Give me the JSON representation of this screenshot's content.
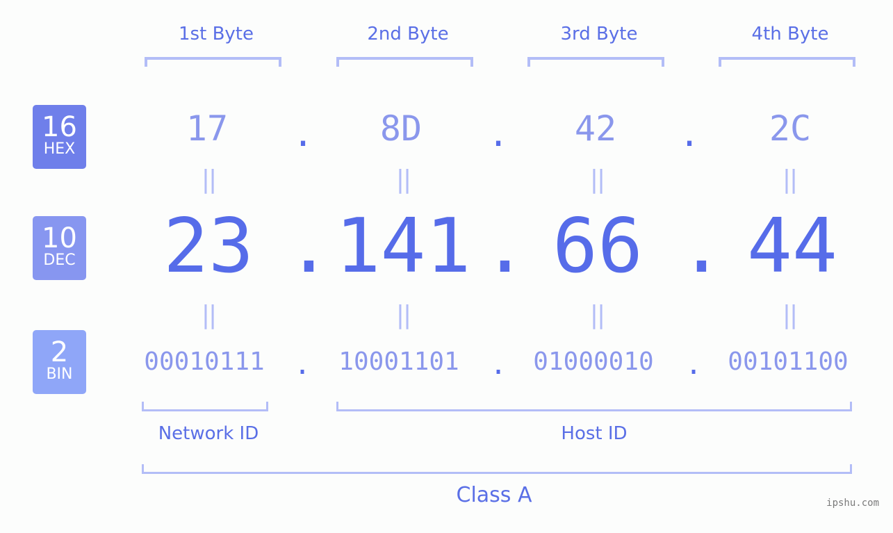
{
  "ip_address": "23.141.66.44",
  "bytes": [
    {
      "label": "1st Byte",
      "hex": "17",
      "dec": "23",
      "bin": "00010111"
    },
    {
      "label": "2nd Byte",
      "hex": "8D",
      "dec": "141",
      "bin": "10001101"
    },
    {
      "label": "3rd Byte",
      "hex": "42",
      "dec": "66",
      "bin": "01000010"
    },
    {
      "label": "4th Byte",
      "hex": "2C",
      "dec": "44",
      "bin": "00101100"
    }
  ],
  "separator": ".",
  "equals": "||",
  "badges": {
    "hex": {
      "base": "16",
      "name": "HEX",
      "color": "#6f7fea"
    },
    "dec": {
      "base": "10",
      "name": "DEC",
      "color": "#8796f0"
    },
    "bin": {
      "base": "2",
      "name": "BIN",
      "color": "#8fa6f8"
    }
  },
  "segments": {
    "network": "Network ID",
    "host": "Host ID",
    "class": "Class A"
  },
  "watermark": "ipshu.com",
  "colors": {
    "accent": "#566ce9",
    "light": "#8a97ec",
    "bracket": "#b3bdf7",
    "background": "#fcfdfc"
  }
}
